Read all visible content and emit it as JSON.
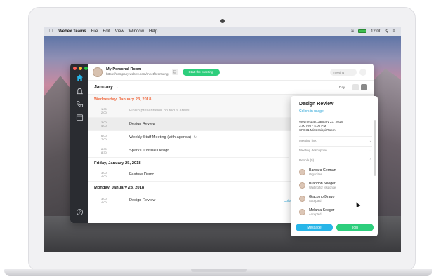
{
  "menubar": {
    "app_name": "Webex Teams",
    "menus": [
      "File",
      "Edit",
      "View",
      "Window",
      "Help"
    ],
    "clock": "12:00"
  },
  "room": {
    "title": "My Personal Room",
    "url": "https://company.webex.com/meet/brenseng",
    "start_label": "Start the Meeting",
    "search_placeholder": "meeting"
  },
  "calendar": {
    "month": "January",
    "view_label": "Day",
    "days": [
      {
        "header": "Wednesday, January 23, 2018",
        "events": [
          {
            "start": "1:00",
            "end": "2:00",
            "title": "Finish presentation on focus areas"
          },
          {
            "start": "3:00",
            "end": "4:00",
            "title": "Design Review"
          },
          {
            "start": "6:00",
            "end": "7:00",
            "title": "Weekly Staff Meeting (with agenda)"
          },
          {
            "start": "8:00",
            "end": "8:30",
            "title": "Spark UI Visual Design"
          }
        ]
      },
      {
        "header": "Friday, January 25, 2018",
        "events": [
          {
            "start": "3:00",
            "end": "4:00",
            "title": "Feature Demo"
          }
        ]
      },
      {
        "header": "Monday, January 28, 2018",
        "events": [
          {
            "start": "3:00",
            "end": "4:00",
            "title": "Design Review",
            "link": "Colors in usage"
          }
        ]
      }
    ]
  },
  "popover": {
    "title": "Design Review",
    "subtitle": "Colors in usage",
    "date": "Wednesday, January 23, 2018",
    "time": "3:00 PM - 4:00 PM",
    "location": "SFO31 Mississippi Room",
    "sections": {
      "meeting_link": "Meeting link",
      "meeting_description": "Meeting description",
      "people": "People (5)"
    },
    "people": [
      {
        "name": "Barbara German",
        "status": "Organizer"
      },
      {
        "name": "Brandon Seeger",
        "status": "Waiting for response"
      },
      {
        "name": "Giacomo Drago",
        "status": "Accepted"
      },
      {
        "name": "Melania Seeger",
        "status": "Accepted"
      }
    ],
    "message_label": "Message",
    "join_label": "Join"
  },
  "colors": {
    "accent_blue": "#27b5e8",
    "accent_green": "#2dce7c",
    "today_orange": "#f0724a",
    "sidebar": "#2a2c31"
  },
  "icons": {
    "sidebar": [
      "home-icon",
      "bell-icon",
      "phone-icon",
      "calendar-icon",
      "help-icon"
    ]
  }
}
